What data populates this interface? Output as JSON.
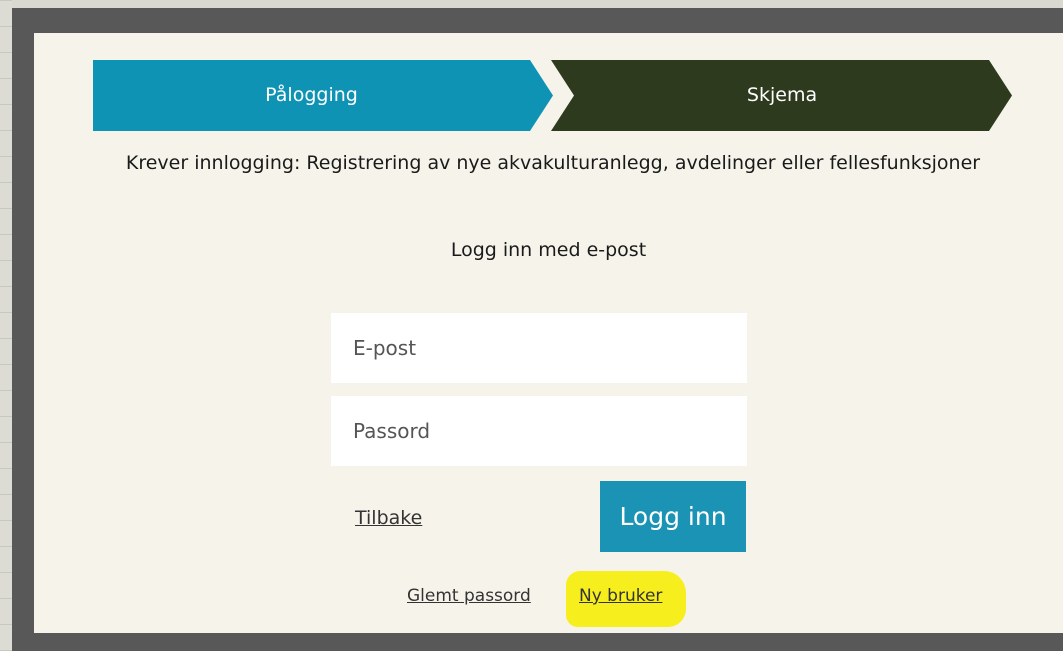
{
  "steps": [
    {
      "label": "Pålogging",
      "color": "#0f93b4",
      "state": "active"
    },
    {
      "label": "Skjema",
      "color": "#2e3a1e",
      "state": "upcoming"
    }
  ],
  "message": {
    "headline": "Krever innlogging: Registrering av nye akvakulturanlegg, avdelinger eller fellesfunksjoner",
    "subhead": "Logg inn med e-post"
  },
  "form": {
    "email_placeholder": "E-post",
    "email_value": "",
    "password_placeholder": "Passord",
    "password_value": ""
  },
  "actions": {
    "back_label": "Tilbake",
    "login_label": "Logg inn",
    "forgot_label": "Glemt passord",
    "new_user_label": "Ny bruker"
  },
  "icons": {
    "close": "close-icon"
  },
  "colors": {
    "primary_button": "#1a93b4",
    "modal_background": "#f6f4ea",
    "highlight": "#f7ee1e"
  }
}
